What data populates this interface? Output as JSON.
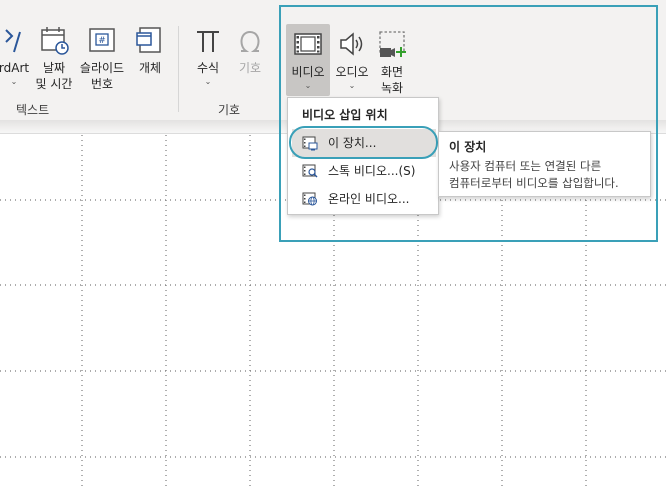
{
  "ribbon": {
    "buttons": {
      "wordart": {
        "label": "rdArt"
      },
      "date_time": {
        "label_line1": "날짜",
        "label_line2": "및 시간"
      },
      "slide_number": {
        "label_line1": "슬라이드",
        "label_line2": "번호"
      },
      "object": {
        "label": "개체"
      },
      "equation": {
        "label": "수식"
      },
      "symbol": {
        "label": "기호"
      },
      "video": {
        "label": "비디오"
      },
      "audio": {
        "label": "오디오"
      },
      "screen_recording": {
        "label_line1": "화면",
        "label_line2": "녹화"
      }
    },
    "groups": {
      "text": "텍스트",
      "symbols": "기호"
    }
  },
  "dropdown": {
    "title": "비디오 삽입 위치",
    "items": [
      {
        "label": "이 장치...",
        "selected": true
      },
      {
        "label": "스톡 비디오...(S)",
        "selected": false
      },
      {
        "label": "온라인 비디오...",
        "selected": false
      }
    ]
  },
  "tooltip": {
    "title": "이 장치",
    "line1": "사용자 컴퓨터 또는 연결된 다른",
    "line2": "컴퓨터로부터 비디오를 삽입합니다."
  },
  "colors": {
    "highlight": "#3aa0b8",
    "selected_bg": "#e1dfdd",
    "accent_blue": "#2b579a",
    "green": "#33a02c"
  }
}
